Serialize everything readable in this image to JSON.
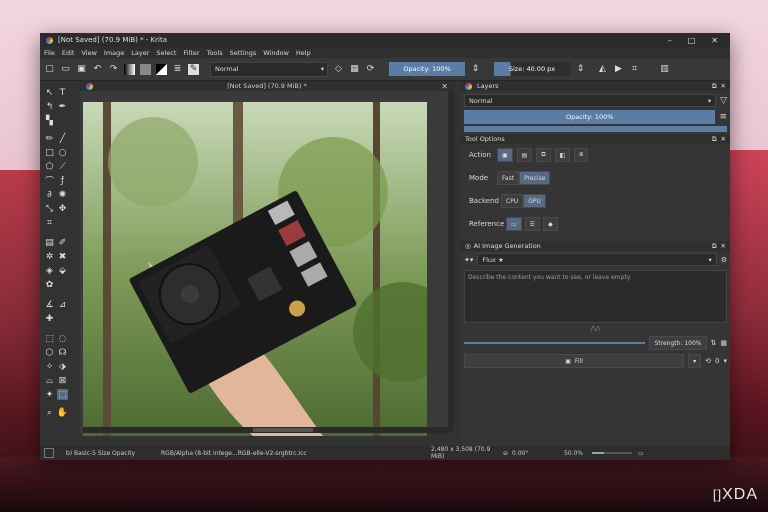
{
  "window": {
    "title": "[Not Saved]  (70.9 MiB) * - Krita"
  },
  "menu": [
    "File",
    "Edit",
    "View",
    "Image",
    "Layer",
    "Select",
    "Filter",
    "Tools",
    "Settings",
    "Window",
    "Help"
  ],
  "toolbar": {
    "blend_mode": "Normal",
    "opacity": "Opacity: 100%",
    "size": "Size: 40.00 px"
  },
  "document": {
    "tab_title": "[Not Saved]  (70.9 MiB) *"
  },
  "layers": {
    "title": "Layers",
    "blend_mode": "Normal",
    "opacity": "Opacity: 100%"
  },
  "tool_options": {
    "title": "Tool Options",
    "action_label": "Action",
    "mode_label": "Mode",
    "mode_fast": "Fast",
    "mode_precise": "Precise",
    "backend_label": "Backend",
    "backend_cpu": "CPU",
    "backend_gpu": "GPU",
    "reference_label": "Reference"
  },
  "ai": {
    "title": "AI Image Generation",
    "model": "Flux ★",
    "prompt_placeholder": "Describe the content you want to see, or leave empty.",
    "strength": "Strength: 100%",
    "fill_button": "Fill",
    "queue_count": "0"
  },
  "status": {
    "brush": "b) Basic-5 Size Opacity",
    "color_space": "RGB/Alpha (8-bit intege...RGB-elle-V2-srgbtrc.icc",
    "dimensions": "2,480 x 3,508 (70.9 MiB)",
    "rotation": "0.00°",
    "zoom": "50.0%"
  },
  "watermark": "XDA"
}
